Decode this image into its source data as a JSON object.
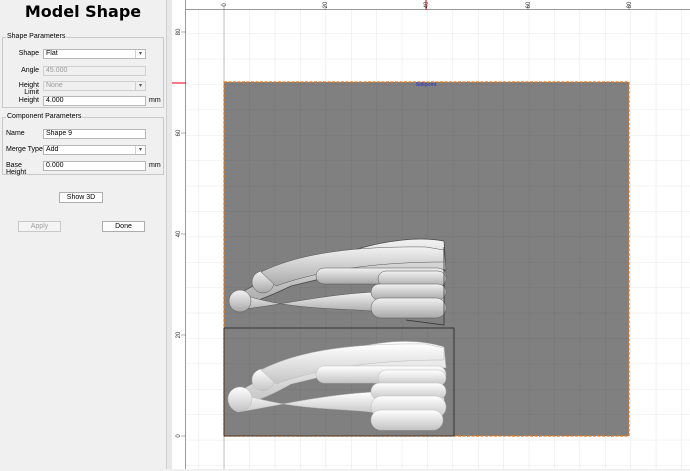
{
  "title": "Model Shape",
  "shape_params": {
    "header": "Shape Parameters",
    "shape_label": "Shape",
    "shape_value": "Flat",
    "angle_label": "Angle",
    "angle_value": "45.000",
    "height_limit_label": "Height Limit",
    "height_limit_value": "None",
    "height_label": "Height",
    "height_value": "4.000",
    "height_unit": "mm"
  },
  "component_params": {
    "header": "Component Parameters",
    "name_label": "Name",
    "name_value": "Shape 9",
    "merge_label": "Merge Type",
    "merge_value": "Add",
    "base_height_label": "Base Height",
    "base_height_value": "0.000",
    "base_height_unit": "mm"
  },
  "buttons": {
    "show3d": "Show 3D",
    "apply": "Apply",
    "done": "Done"
  },
  "rulers": {
    "horizontal_ticks": [
      "0",
      "20",
      "40",
      "60",
      "80"
    ],
    "vertical_ticks": [
      "80",
      "60",
      "40",
      "20",
      "0"
    ]
  },
  "canvas": {
    "marker_label": "Stillpoint",
    "colors": {
      "workspace": "#808080",
      "border": "#e8751a",
      "shape_fill": "#d9d9d9"
    }
  }
}
